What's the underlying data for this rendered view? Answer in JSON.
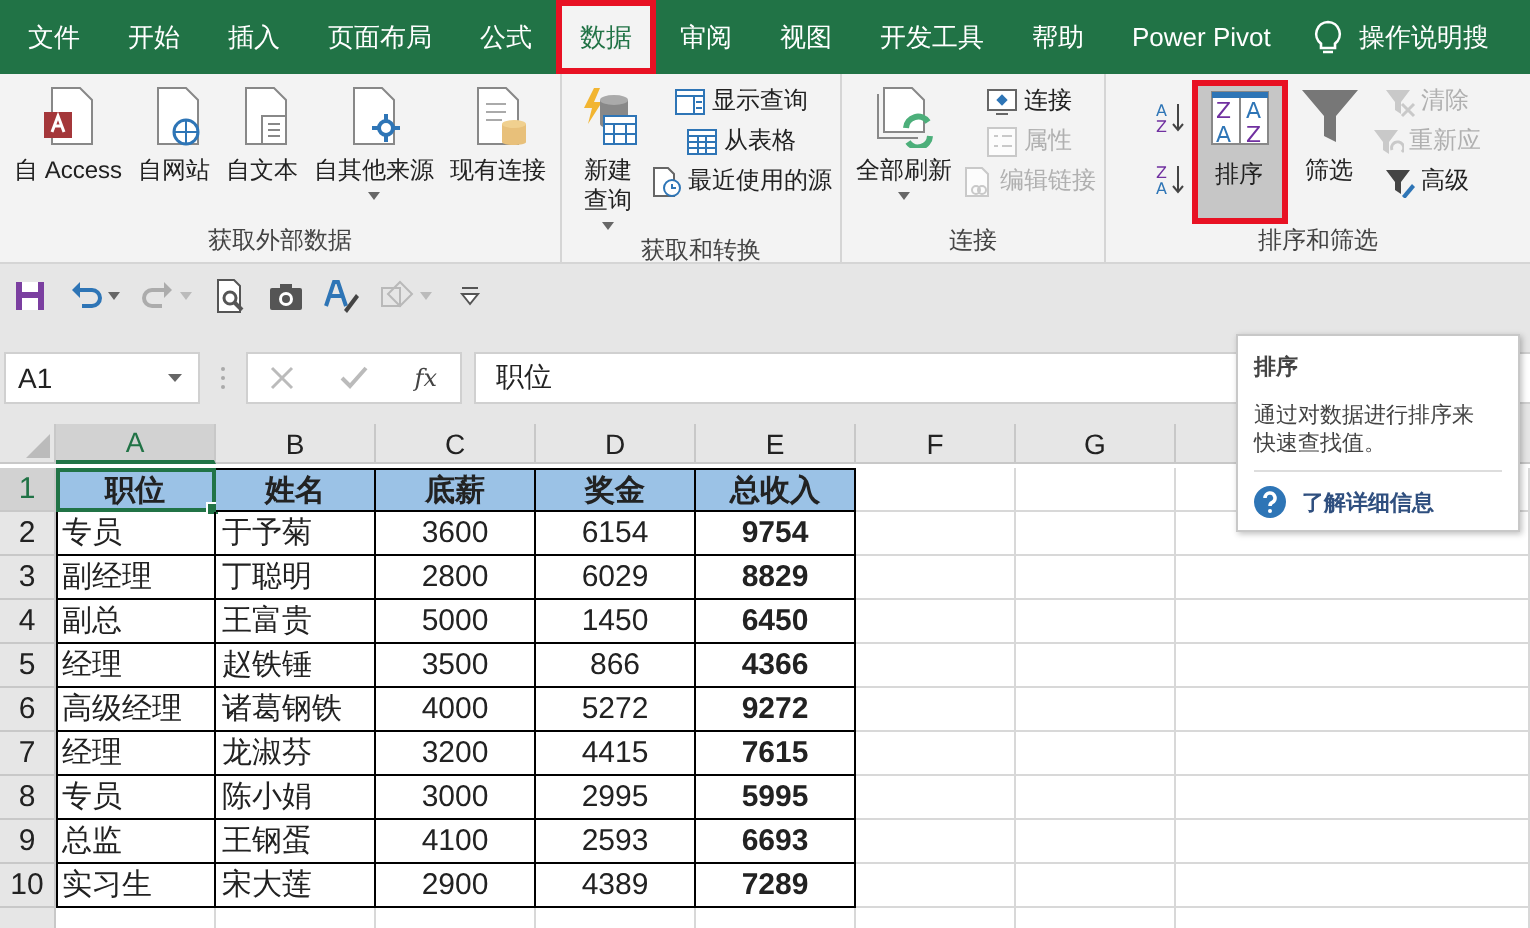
{
  "ribbon_tabs": [
    {
      "label": "文件",
      "selected": false
    },
    {
      "label": "开始",
      "selected": false
    },
    {
      "label": "插入",
      "selected": false
    },
    {
      "label": "页面布局",
      "selected": false
    },
    {
      "label": "公式",
      "selected": false
    },
    {
      "label": "数据",
      "selected": true
    },
    {
      "label": "审阅",
      "selected": false
    },
    {
      "label": "视图",
      "selected": false
    },
    {
      "label": "开发工具",
      "selected": false
    },
    {
      "label": "帮助",
      "selected": false
    },
    {
      "label": "Power Pivot",
      "selected": false
    }
  ],
  "tell_me": {
    "text": "操作说明搜"
  },
  "ribbon_groups": [
    {
      "label": "获取外部数据",
      "buttons": [
        {
          "kind": "large",
          "label": "自 Access",
          "disabled": false,
          "dropdown": false,
          "selected": false
        },
        {
          "kind": "large",
          "label": "自网站",
          "disabled": false,
          "dropdown": false,
          "selected": false
        },
        {
          "kind": "large",
          "label": "自文本",
          "disabled": false,
          "dropdown": false,
          "selected": false
        },
        {
          "kind": "large",
          "label": "自其他来源",
          "disabled": false,
          "dropdown": true,
          "selected": false
        },
        {
          "kind": "large",
          "label": "现有连接",
          "disabled": false,
          "dropdown": false,
          "selected": false
        }
      ]
    },
    {
      "label": "获取和转换",
      "buttons": [
        {
          "kind": "large",
          "label": "新建查询",
          "disabled": false,
          "dropdown": true,
          "selected": false
        },
        {
          "kind": "small",
          "label": "显示查询",
          "disabled": false,
          "dropdown": false,
          "selected": false
        },
        {
          "kind": "small",
          "label": "从表格",
          "disabled": false,
          "dropdown": false,
          "selected": false
        },
        {
          "kind": "small",
          "label": "最近使用的源",
          "disabled": false,
          "dropdown": false,
          "selected": false
        }
      ]
    },
    {
      "label": "连接",
      "buttons": [
        {
          "kind": "large",
          "label": "全部刷新",
          "disabled": false,
          "dropdown": true,
          "selected": false
        },
        {
          "kind": "small",
          "label": "连接",
          "disabled": false,
          "dropdown": false,
          "selected": false
        },
        {
          "kind": "small",
          "label": "属性",
          "disabled": true,
          "dropdown": false,
          "selected": false
        },
        {
          "kind": "small",
          "label": "编辑链接",
          "disabled": true,
          "dropdown": false,
          "selected": false
        }
      ]
    },
    {
      "label": "排序和筛选",
      "buttons": [
        {
          "kind": "icon",
          "letters": [
            "A",
            "Z"
          ],
          "disabled": false,
          "dropdown": false,
          "selected": false
        },
        {
          "kind": "icon",
          "letters": [
            "Z",
            "A"
          ],
          "disabled": false,
          "dropdown": false,
          "selected": false
        },
        {
          "kind": "large",
          "label": "排序",
          "letters": [
            "Z",
            "A",
            "A",
            "Z"
          ],
          "disabled": false,
          "dropdown": false,
          "selected": true
        },
        {
          "kind": "large",
          "label": "筛选",
          "disabled": false,
          "dropdown": false,
          "selected": false
        },
        {
          "kind": "small",
          "label": "清除",
          "disabled": true,
          "dropdown": false,
          "selected": false
        },
        {
          "kind": "small",
          "label": "重新应",
          "disabled": true,
          "dropdown": false,
          "selected": false
        },
        {
          "kind": "small",
          "label": "高级",
          "disabled": false,
          "dropdown": false,
          "selected": false
        }
      ]
    }
  ],
  "quick_access_toolbar": [
    {
      "disabled": false,
      "dropdown": false
    },
    {
      "disabled": false,
      "dropdown": true
    },
    {
      "disabled": true,
      "dropdown": true
    },
    {
      "disabled": false,
      "dropdown": false
    },
    {
      "disabled": false,
      "dropdown": false
    },
    {
      "disabled": false,
      "dropdown": false
    },
    {
      "disabled": true,
      "dropdown": true
    },
    {
      "disabled": false,
      "dropdown": false
    }
  ],
  "formula_bar": {
    "name_box": "A1",
    "function_label": "fx",
    "value": "职位"
  },
  "sheet": {
    "columns": [
      {
        "label": "A",
        "selected": true
      },
      {
        "label": "B",
        "selected": false
      },
      {
        "label": "C",
        "selected": false
      },
      {
        "label": "D",
        "selected": false
      },
      {
        "label": "E",
        "selected": false
      },
      {
        "label": "F",
        "selected": false
      },
      {
        "label": "G",
        "selected": false
      }
    ],
    "rows": [
      {
        "number": "1",
        "selected": true,
        "cells": [
          "职位",
          "姓名",
          "底薪",
          "奖金",
          "总收入"
        ]
      },
      {
        "number": "2",
        "selected": false,
        "cells": [
          "专员",
          "于予菊",
          "3600",
          "6154",
          "9754"
        ]
      },
      {
        "number": "3",
        "selected": false,
        "cells": [
          "副经理",
          "丁聪明",
          "2800",
          "6029",
          "8829"
        ]
      },
      {
        "number": "4",
        "selected": false,
        "cells": [
          "副总",
          "王富贵",
          "5000",
          "1450",
          "6450"
        ]
      },
      {
        "number": "5",
        "selected": false,
        "cells": [
          "经理",
          "赵铁锤",
          "3500",
          "866",
          "4366"
        ]
      },
      {
        "number": "6",
        "selected": false,
        "cells": [
          "高级经理",
          "诸葛钢铁",
          "4000",
          "5272",
          "9272"
        ]
      },
      {
        "number": "7",
        "selected": false,
        "cells": [
          "经理",
          "龙淑芬",
          "3200",
          "4415",
          "7615"
        ]
      },
      {
        "number": "8",
        "selected": false,
        "cells": [
          "专员",
          "陈小娟",
          "3000",
          "2995",
          "5995"
        ]
      },
      {
        "number": "9",
        "selected": false,
        "cells": [
          "总监",
          "王钢蛋",
          "4100",
          "2593",
          "6693"
        ]
      },
      {
        "number": "10",
        "selected": false,
        "cells": [
          "实习生",
          "宋大莲",
          "2900",
          "4389",
          "7289"
        ]
      }
    ]
  },
  "tooltip": {
    "title": "排序",
    "text": "通过对数据进行排序来快速查找值。",
    "link": "了解详细信息"
  }
}
